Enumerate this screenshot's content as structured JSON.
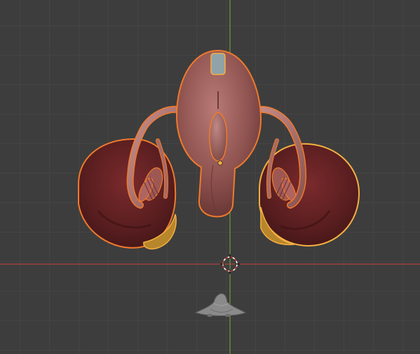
{
  "viewport": {
    "view": "3D Viewport",
    "background_color": "#3d3d3d",
    "grid_color": "#4a4a4a",
    "x_axis_color": "#b0433f",
    "y_axis_color": "#6f9a3a",
    "selection_outline_color": "#f07a2c",
    "active_outline_color": "#f5b041"
  },
  "objects": [
    {
      "name": "uterus-body",
      "selected": true
    },
    {
      "name": "left-ovary",
      "selected": true
    },
    {
      "name": "right-ovary",
      "selected": true
    },
    {
      "name": "small-mesh",
      "selected": false
    }
  ],
  "icons": {
    "cursor": "3d-cursor-icon",
    "origin": "object-origin-icon"
  }
}
